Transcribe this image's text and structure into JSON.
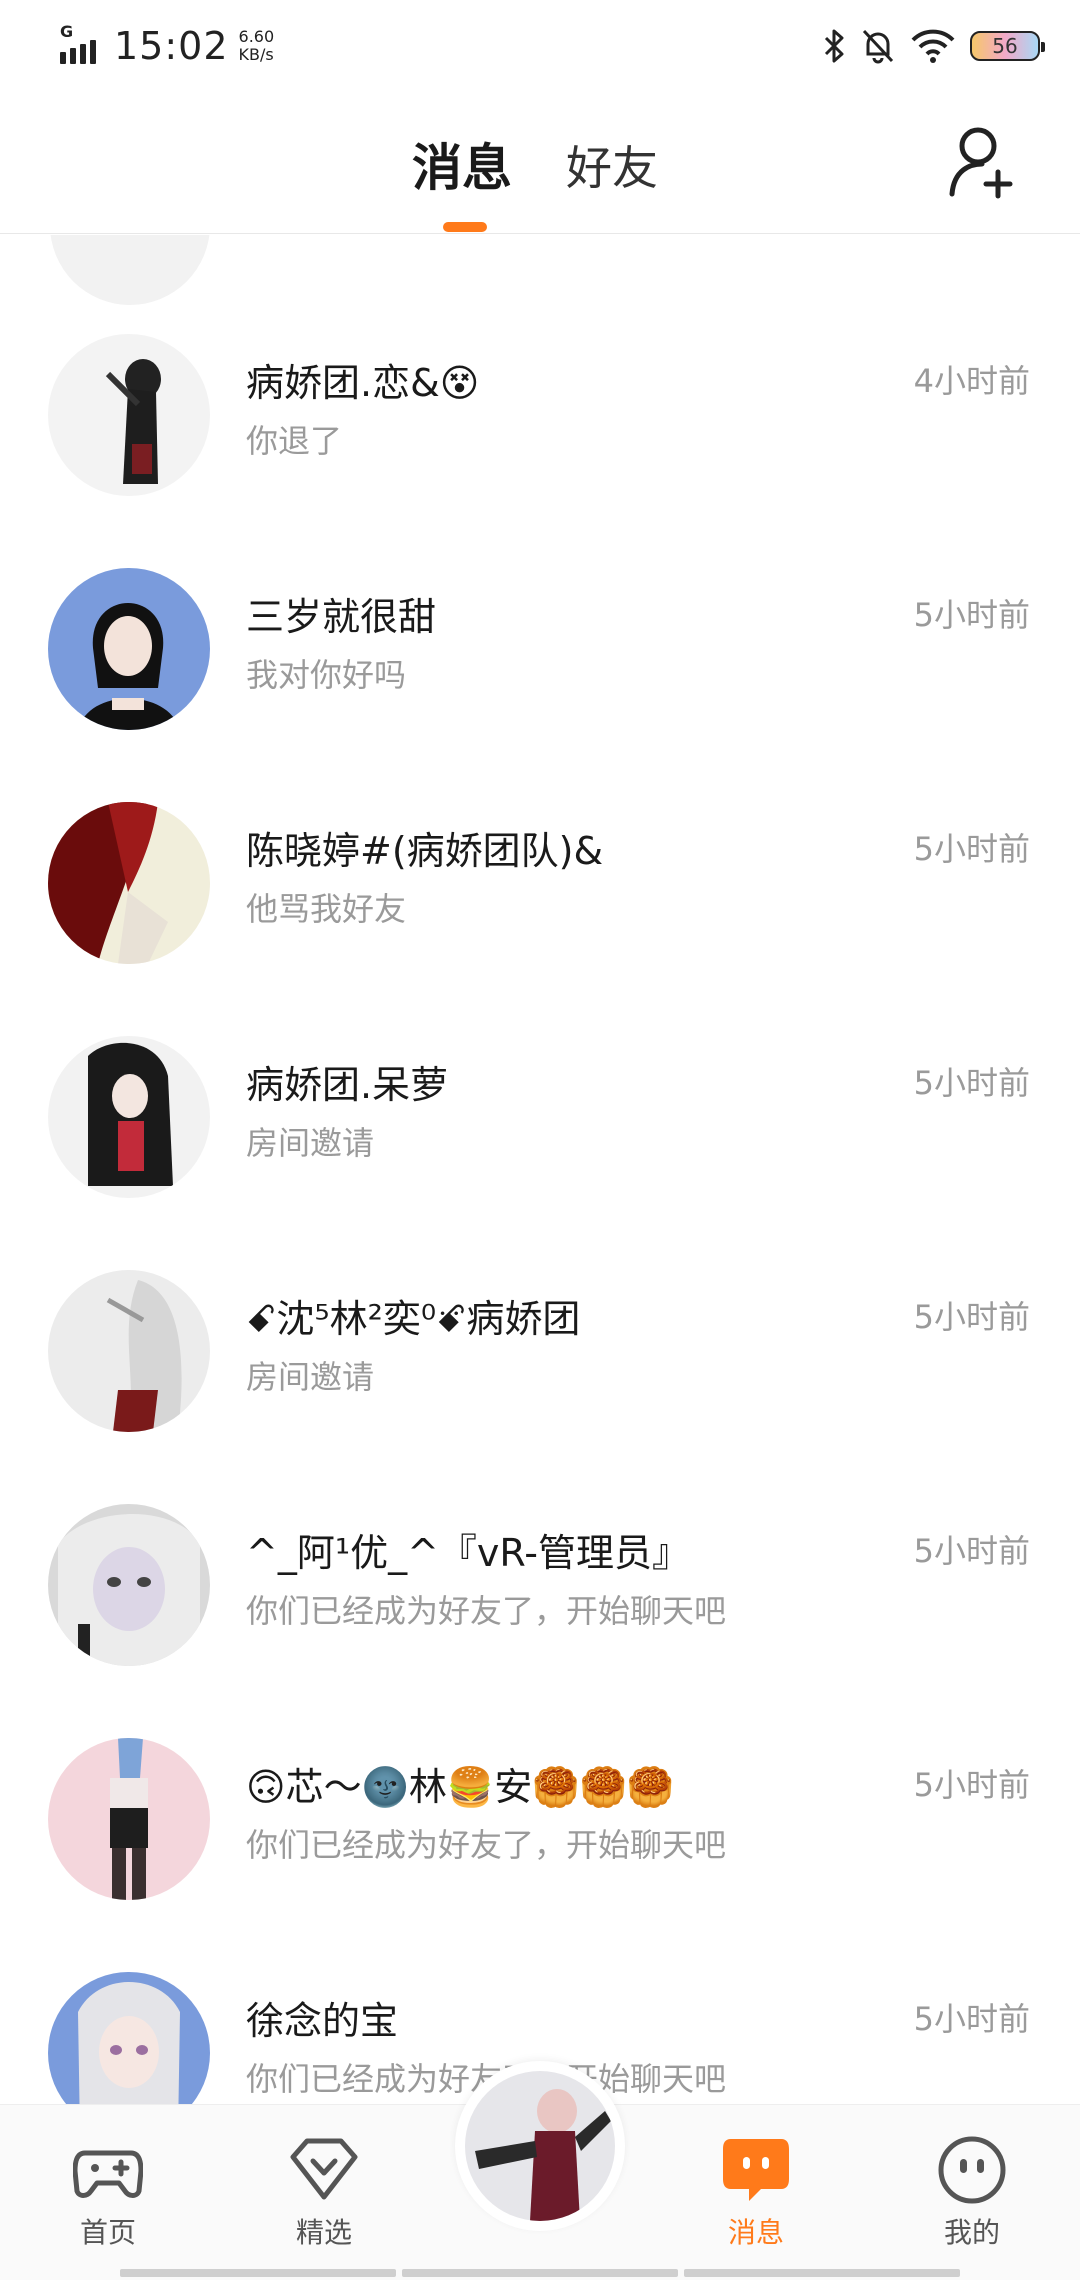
{
  "status_bar": {
    "network": "G",
    "time": "15:02",
    "speed_value": "6.60",
    "speed_unit": "KB/s",
    "battery": "56",
    "icons": [
      "bluetooth-icon",
      "bell-off-icon",
      "wifi-icon",
      "battery-icon"
    ]
  },
  "header": {
    "tabs": [
      {
        "label": "消息",
        "active": true
      },
      {
        "label": "好友",
        "active": false
      }
    ],
    "add_friend_icon": "add-person-icon"
  },
  "colors": {
    "accent": "#ff7a1a",
    "text_primary": "#1a1a1a",
    "text_secondary": "#9a9a9a"
  },
  "conversations": [
    {
      "name": "病娇团.恋&😵",
      "preview": "你退了",
      "time": "4小时前"
    },
    {
      "name": "三岁就很甜",
      "preview": "我对你好吗",
      "time": "5小时前"
    },
    {
      "name": "陈晓婷#(病娇团队)&",
      "preview": "他骂我好友",
      "time": "5小时前"
    },
    {
      "name": "病娇团.呆萝",
      "preview": "房间邀请",
      "time": "5小时前"
    },
    {
      "name": "ꗃ沈⁵林²奕⁰ꗄ病娇团",
      "preview": "房间邀请",
      "time": "5小时前"
    },
    {
      "name": "^_阿¹优_^『vR-管理员』",
      "preview": "你们已经成为好友了，开始聊天吧",
      "time": "5小时前"
    },
    {
      "name": "🙃芯～🌚林🍔安🥮🥮🥮",
      "preview": "你们已经成为好友了，开始聊天吧",
      "time": "5小时前"
    },
    {
      "name": "徐念的宝",
      "preview": "你们已经成为好友了，开始聊天吧",
      "time": "5小时前"
    }
  ],
  "bottom_nav": {
    "items": [
      {
        "label": "首页",
        "icon": "gamepad-icon"
      },
      {
        "label": "精选",
        "icon": "heart-diamond-icon"
      },
      {
        "label": "消息",
        "icon": "chat-bubble-icon",
        "active": true
      },
      {
        "label": "我的",
        "icon": "face-icon"
      }
    ]
  }
}
